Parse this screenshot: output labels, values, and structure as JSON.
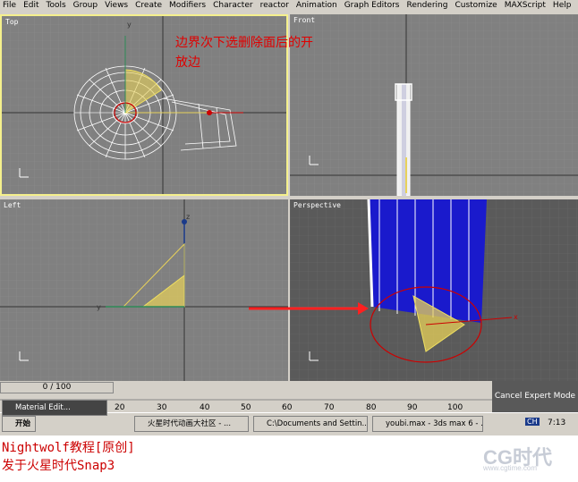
{
  "menu": [
    "File",
    "Edit",
    "Tools",
    "Group",
    "Views",
    "Create",
    "Modifiers",
    "Character",
    "reactor",
    "Animation",
    "Graph Editors",
    "Rendering",
    "Customize",
    "MAXScript",
    "Help"
  ],
  "viewports": {
    "top": "Top",
    "front": "Front",
    "left": "Left",
    "perspective": "Perspective"
  },
  "annotation": {
    "line1": "边界次下选删除面后的开",
    "line2": "放边"
  },
  "time": {
    "slider": "0 / 100",
    "ticks": [
      "20",
      "30",
      "40",
      "50",
      "60",
      "70",
      "80",
      "90",
      "100"
    ]
  },
  "cancel_expert": "Cancel Expert Mode",
  "taskbar": {
    "start": "开始",
    "tasks": [
      "Material Edit...",
      "火星时代动画大社区 - ...",
      "C:\\Documents and Settin...",
      "youbi.max - 3ds max 6 - ..."
    ],
    "clock": "7:13",
    "lang": "CH"
  },
  "captions": {
    "line1": "Nightwolf教程[原创]",
    "line2": "发于火星时代Snap3"
  },
  "watermark": {
    "brand": "CG时代",
    "url": "www.cgtime.com"
  },
  "axes": {
    "x": "x",
    "y": "y",
    "z": "z"
  },
  "colors": {
    "viewport_bg": "#808080",
    "active_border": "#f5f08c",
    "selection": "#e8d25a",
    "accent_red": "#cc0000"
  }
}
